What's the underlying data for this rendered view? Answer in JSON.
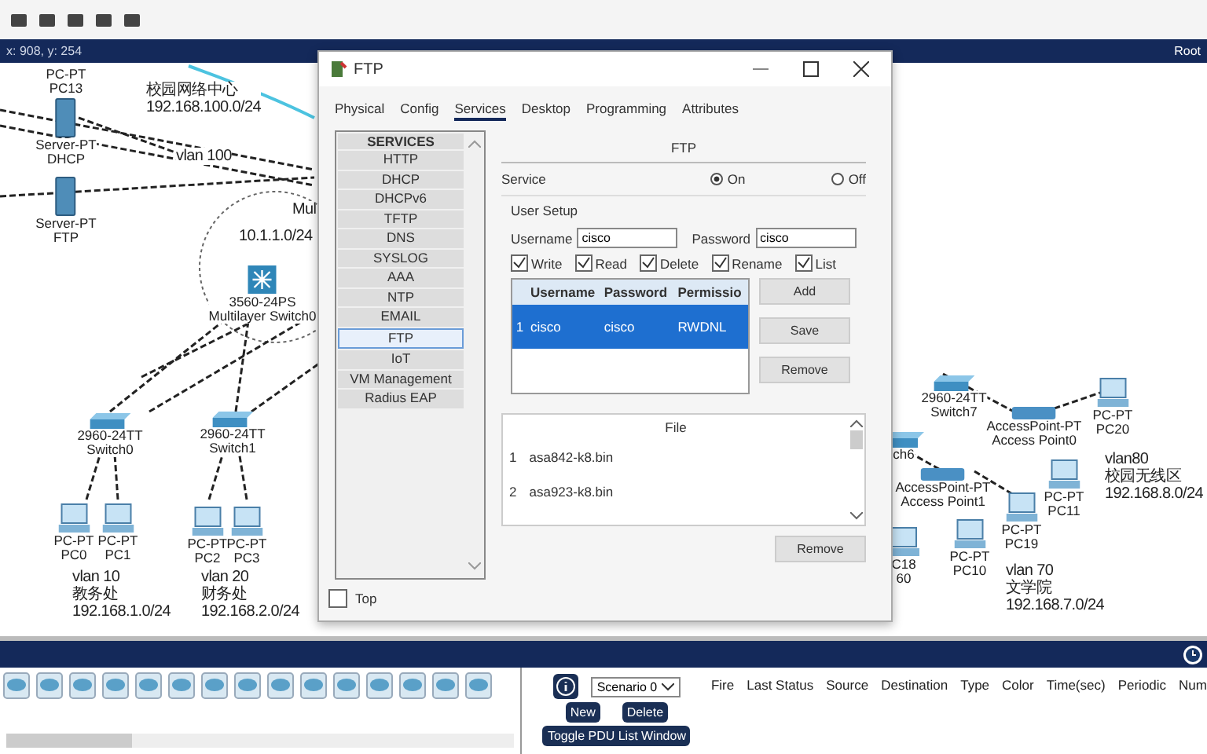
{
  "top_bar": {
    "coordinates": "x: 908, y: 254",
    "mode": "Root"
  },
  "topology": [
    {
      "kind": "label",
      "lines": [
        "PC-PT",
        "PC13"
      ]
    },
    {
      "kind": "server",
      "lines": [
        "Server-PT",
        "DHCP"
      ]
    },
    {
      "kind": "server",
      "lines": [
        "Server-PT",
        "FTP"
      ]
    },
    {
      "kind": "note",
      "lines": [
        "校园网络中心",
        "192.168.100.0/24"
      ]
    },
    {
      "kind": "note",
      "lines": [
        "vlan 100"
      ]
    },
    {
      "kind": "note",
      "lines": [
        "Mul"
      ]
    },
    {
      "kind": "note",
      "lines": [
        "10.1.1.0/24"
      ]
    },
    {
      "kind": "multilayer",
      "lines": [
        "3560-24PS",
        "Multilayer Switch0"
      ]
    },
    {
      "kind": "switch",
      "lines": [
        "2960-24TT",
        "Switch0"
      ]
    },
    {
      "kind": "switch",
      "lines": [
        "2960-24TT",
        "Switch1"
      ]
    },
    {
      "kind": "pc",
      "lines": [
        "PC-PT",
        "PC0"
      ]
    },
    {
      "kind": "pc",
      "lines": [
        "PC-PT",
        "PC1"
      ]
    },
    {
      "kind": "pc",
      "lines": [
        "PC-PT",
        "PC2"
      ]
    },
    {
      "kind": "pc",
      "lines": [
        "PC-PT",
        "PC3"
      ]
    },
    {
      "kind": "note",
      "lines": [
        "vlan 10",
        "教务处",
        "192.168.1.0/24"
      ]
    },
    {
      "kind": "note",
      "lines": [
        "vlan 20",
        "财务处",
        "192.168.2.0/24"
      ]
    },
    {
      "kind": "switch",
      "lines": [
        "2960-24TT",
        "Switch7"
      ]
    },
    {
      "kind": "ap",
      "lines": [
        "AccessPoint-PT",
        "Access Point0"
      ]
    },
    {
      "kind": "pc",
      "lines": [
        "PC-PT",
        "PC20"
      ]
    },
    {
      "kind": "switch",
      "lines": [
        "ch6"
      ]
    },
    {
      "kind": "ap",
      "lines": [
        "AccessPoint-PT",
        "Access Point1"
      ]
    },
    {
      "kind": "pc",
      "lines": [
        "PC-PT",
        "PC11"
      ]
    },
    {
      "kind": "note",
      "lines": [
        "vlan80",
        "校园无线区",
        "192.168.8.0/24"
      ]
    },
    {
      "kind": "pc",
      "lines": [
        "PC-PT",
        "PC19"
      ]
    },
    {
      "kind": "pc",
      "lines": [
        "PC-PT",
        "PC10"
      ]
    },
    {
      "kind": "pc",
      "lines": [
        "C18",
        "60"
      ]
    },
    {
      "kind": "note",
      "lines": [
        "vlan 70",
        "文学院",
        "192.168.7.0/24"
      ]
    }
  ],
  "dialog": {
    "title": "FTP",
    "tabs": [
      {
        "label": "Physical",
        "selected": false
      },
      {
        "label": "Config",
        "selected": false
      },
      {
        "label": "Services",
        "selected": true
      },
      {
        "label": "Desktop",
        "selected": false
      },
      {
        "label": "Programming",
        "selected": false
      },
      {
        "label": "Attributes",
        "selected": false
      }
    ],
    "services_header": "SERVICES",
    "services": [
      {
        "label": "HTTP",
        "selected": false
      },
      {
        "label": "DHCP",
        "selected": false
      },
      {
        "label": "DHCPv6",
        "selected": false
      },
      {
        "label": "TFTP",
        "selected": false
      },
      {
        "label": "DNS",
        "selected": false
      },
      {
        "label": "SYSLOG",
        "selected": false
      },
      {
        "label": "AAA",
        "selected": false
      },
      {
        "label": "NTP",
        "selected": false
      },
      {
        "label": "EMAIL",
        "selected": false
      },
      {
        "label": "FTP",
        "selected": true
      },
      {
        "label": "IoT",
        "selected": false
      },
      {
        "label": "VM Management",
        "selected": false
      },
      {
        "label": "Radius EAP",
        "selected": false
      }
    ],
    "panel_title": "FTP",
    "service": {
      "label": "Service",
      "options": [
        {
          "label": "On",
          "selected": true
        },
        {
          "label": "Off",
          "selected": false
        }
      ]
    },
    "user_setup": {
      "title": "User Setup",
      "username_label": "Username",
      "username": "cisco",
      "password_label": "Password",
      "password": "cisco",
      "permissions": [
        {
          "label": "Write",
          "checked": true
        },
        {
          "label": "Read",
          "checked": true
        },
        {
          "label": "Delete",
          "checked": true
        },
        {
          "label": "Rename",
          "checked": true
        },
        {
          "label": "List",
          "checked": true
        }
      ],
      "columns": [
        "Username",
        "Password",
        "Permissio"
      ],
      "rows": [
        {
          "index": "1",
          "cells": [
            "cisco",
            "cisco",
            "RWDNL"
          ],
          "selected": true
        }
      ],
      "buttons": [
        "Add",
        "Save",
        "Remove"
      ]
    },
    "files": {
      "header": "File",
      "rows": [
        {
          "index": "1",
          "name": "asa842-k8.bin"
        },
        {
          "index": "2",
          "name": "asa923-k8.bin"
        }
      ],
      "button": "Remove"
    },
    "top": {
      "label": "Top",
      "checked": false
    }
  },
  "pdu_panel": {
    "scenario": "Scenario 0",
    "buttons": [
      "New",
      "Delete"
    ],
    "toggle": "Toggle PDU List Window",
    "columns": [
      "Fire",
      "Last Status",
      "Source",
      "Destination",
      "Type",
      "Color",
      "Time(sec)",
      "Periodic",
      "Num"
    ]
  }
}
